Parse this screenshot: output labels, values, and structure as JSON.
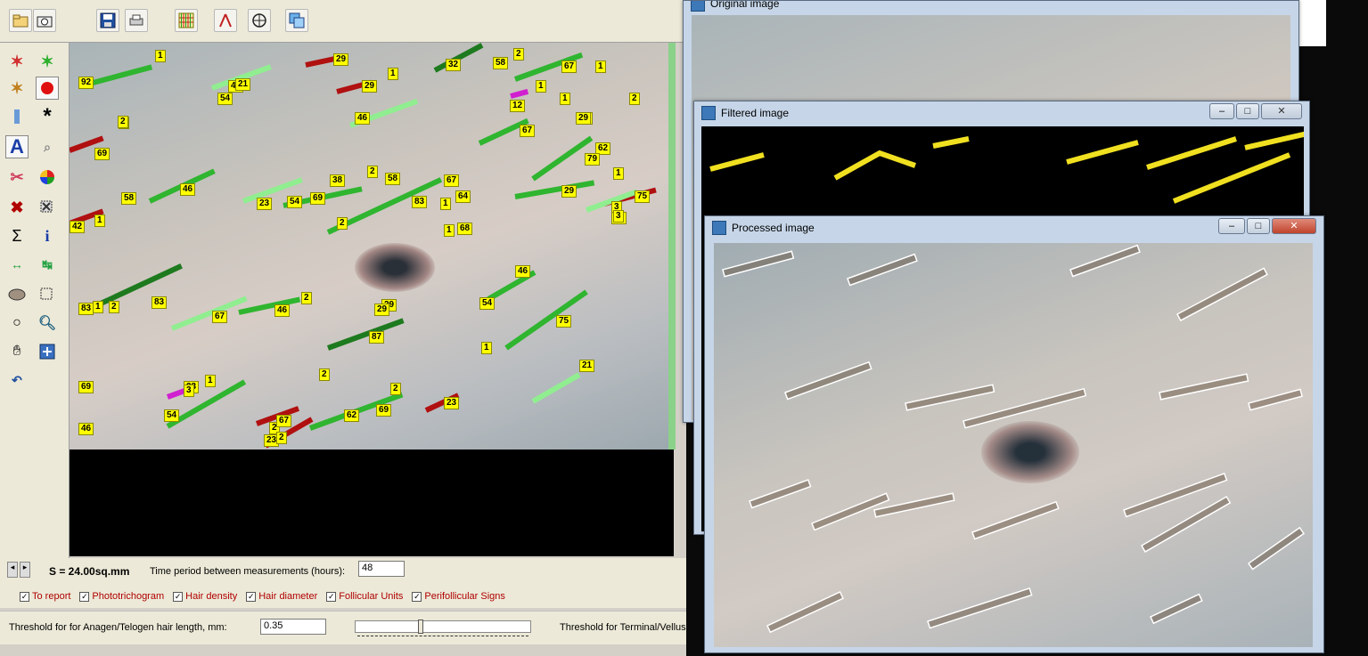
{
  "toolbar": {
    "icons": [
      "open-folder-icon",
      "camera-icon",
      "save-disk-icon",
      "print-icon",
      "grid-icon",
      "compass-icon",
      "target-icon",
      "layers-icon"
    ]
  },
  "palette": {
    "icons": [
      "magic-wand-icon",
      "magic-wand-icon",
      "magic-wand-icon",
      "red-dot-icon",
      "vertical-bar-icon",
      "asterisk-icon",
      "text-tool-icon",
      "zoom-icon",
      "cross-scissors-icon",
      "color-wheel-icon",
      "delete-x-icon",
      "select-delete-icon",
      "sigma-icon",
      "info-icon",
      "arrows-green-icon",
      "arrows-green-icon",
      "ellipse-icon",
      "select-rect-icon",
      "lasso-icon",
      "zoom-in-icon",
      "hand-icon",
      "fit-icon",
      "undo-icon"
    ],
    "text_tool": "A",
    "sigma": "Σ",
    "info": "i"
  },
  "measure": {
    "area_label": "S = 24.00sq.mm",
    "time_label": "Time period between measurements (hours):",
    "time_value": "48"
  },
  "checks": [
    {
      "label": "To report",
      "checked": true
    },
    {
      "label": "Phototrichogram",
      "checked": true
    },
    {
      "label": "Hair density",
      "checked": true
    },
    {
      "label": "Hair diameter",
      "checked": true
    },
    {
      "label": "Follicular Units",
      "checked": true
    },
    {
      "label": "Perifollicular Signs",
      "checked": true
    }
  ],
  "threshold": {
    "anagen_label": "Threshold for for Anagen/Telogen hair length, mm:",
    "anagen_value": "0.35",
    "terminal_label": "Threshold for Terminal/Vellus h"
  },
  "windows": {
    "original": {
      "title": "Original image"
    },
    "filtered": {
      "title": "Filtered image"
    },
    "processed": {
      "title": "Processed image"
    }
  },
  "hair_labels": [
    "1",
    "29",
    "2",
    "92",
    "46",
    "21",
    "54",
    "29",
    "1",
    "32",
    "58",
    "2",
    "67",
    "1",
    "1",
    "29",
    "46",
    "12",
    "1",
    "29",
    "2",
    "67",
    "2",
    "69",
    "62",
    "79",
    "1",
    "46",
    "38",
    "2",
    "54",
    "23",
    "69",
    "83",
    "1",
    "58",
    "67",
    "29",
    "75",
    "1",
    "58",
    "64",
    "3",
    "29",
    "42",
    "2",
    "68",
    "1",
    "3",
    "83",
    "2",
    "29",
    "46",
    "75",
    "83",
    "1",
    "54",
    "67",
    "46",
    "2",
    "29",
    "87",
    "1",
    "2",
    "69",
    "23",
    "46",
    "3",
    "1",
    "2",
    "2",
    "21",
    "23",
    "67",
    "23",
    "62",
    "69",
    "54",
    "2"
  ],
  "colors": {
    "light_green": "#90ee90",
    "green": "#2fb52f",
    "dark_green": "#1e7a1e",
    "red": "#b01010",
    "magenta": "#d020d0",
    "label": "#ffff00"
  }
}
